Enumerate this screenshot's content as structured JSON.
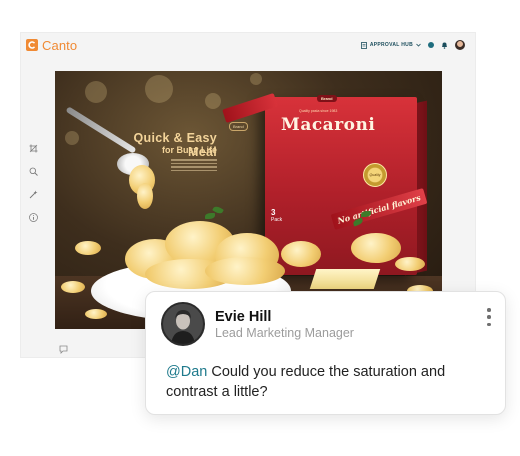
{
  "app": {
    "logo_text": "Canto",
    "brand_color": "#f08a34"
  },
  "header": {
    "approval_label": "APPROVAL HUB",
    "approval_icon": "document-icon",
    "approval_dropdown_icon": "chevron-down-icon",
    "status_icon": "status-dot-icon",
    "notification_icon": "bell-icon",
    "avatar": "user-avatar"
  },
  "toolbar": {
    "tools": [
      {
        "icon": "crop-icon"
      },
      {
        "icon": "zoom-icon"
      },
      {
        "icon": "magic-wand-icon"
      },
      {
        "icon": "info-icon"
      }
    ],
    "comment_icon": "comment-icon"
  },
  "asset": {
    "ad_tag": "Brand",
    "headline": "Quick & Easy Meal",
    "subline": "for Busy Life",
    "box_brand": "Brand",
    "box_quality": "Quality pasta since 1983",
    "box_title": "Macaroni",
    "box_pack_count": "3",
    "box_pack_label": "Pack",
    "ribbon_text": "No artificial flavors"
  },
  "comment": {
    "author": "Evie Hill",
    "role": "Lead Marketing Manager",
    "mention": "@Dan",
    "text": " Could you reduce the saturation and contrast a little?",
    "mention_color": "#1f7a8c",
    "menu_icon": "more-vertical-icon"
  }
}
